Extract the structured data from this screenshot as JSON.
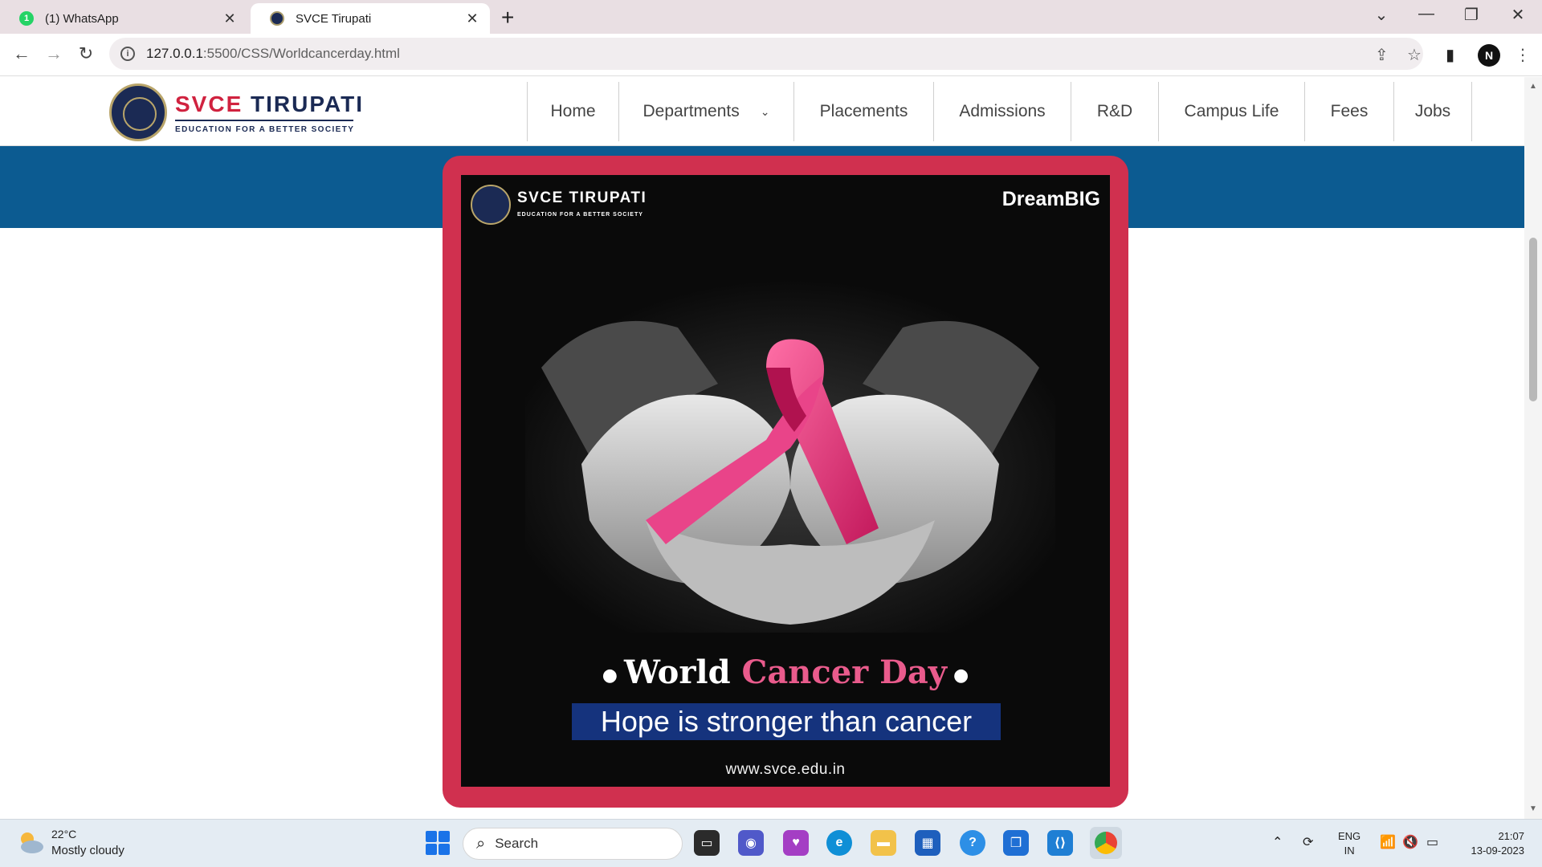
{
  "browser": {
    "tabs": [
      {
        "title": "(1) WhatsApp",
        "badge": "1"
      },
      {
        "title": "SVCE Tirupati"
      }
    ],
    "new_tab": "+",
    "address": {
      "host": "127.0.0.1",
      "path": ":5500/CSS/Worldcancerday.html"
    },
    "profile_initial": "N"
  },
  "site": {
    "brand": {
      "part1": "SVCE",
      "part2": "TIRUPATI",
      "tagline": "EDUCATION FOR A BETTER SOCIETY"
    },
    "nav": [
      "Home",
      "Departments",
      "Placements",
      "Admissions",
      "R&D",
      "Campus Life",
      "Fees",
      "Jobs"
    ],
    "poster": {
      "brand": "SVCE TIRUPATI",
      "tagline": "EDUCATION FOR A BETTER SOCIETY",
      "corner_text": "DreamBIG",
      "title_white": "World",
      "title_pink": "Cancer Day",
      "slogan": "Hope is stronger than cancer",
      "url": "www.svce.edu.in"
    }
  },
  "taskbar": {
    "weather": {
      "temp": "22°C",
      "condition": "Mostly cloudy"
    },
    "search_placeholder": "Search",
    "language": {
      "line1": "ENG",
      "line2": "IN"
    },
    "time": "21:07",
    "date": "13-09-2023"
  },
  "colors": {
    "frame": "#d0304f",
    "band": "#0c5b91",
    "slogan_bg": "#15337d",
    "pink": "#e95b8c",
    "navy": "#1b2a54"
  }
}
